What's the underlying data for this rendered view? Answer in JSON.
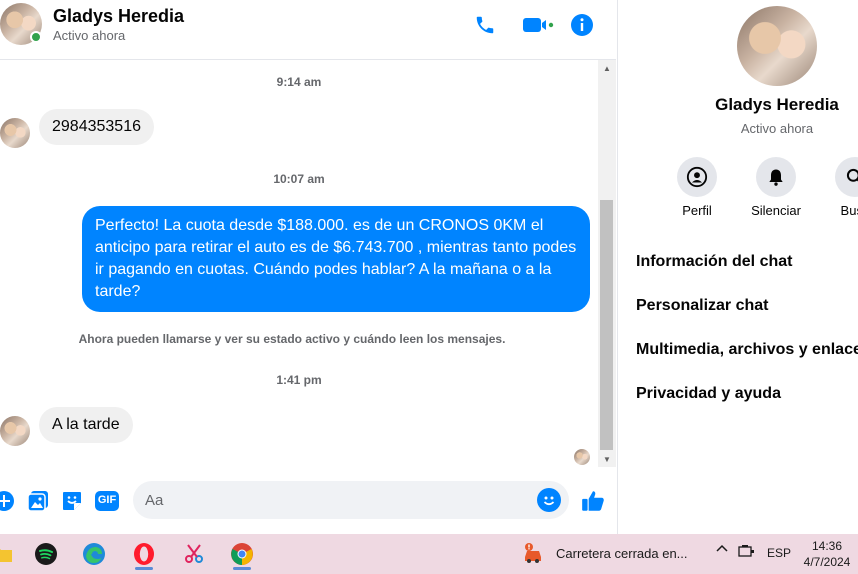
{
  "header": {
    "name": "Gladys Heredia",
    "status": "Activo ahora"
  },
  "chat": {
    "timestamps": [
      "9:14 am",
      "10:07 am",
      "1:41 pm"
    ],
    "messages": {
      "in1": "2984353516",
      "out1": "Perfecto! La cuota desde $188.000. es de un CRONOS 0KM el anticipo para retirar el auto es de $6.743.700 , mientras tanto podes ir pagando en cuotas. Cuándo podes hablar? A la mañana o a la tarde?",
      "in2": "A la tarde"
    },
    "notice": "Ahora pueden llamarse y ver su estado activo y cuándo leen los mensajes."
  },
  "composer": {
    "placeholder": "Aa",
    "gif_label": "GIF"
  },
  "side": {
    "name": "Gladys Heredia",
    "status": "Activo ahora",
    "actions": [
      {
        "label": "Perfil"
      },
      {
        "label": "Silenciar"
      },
      {
        "label": "Busc"
      }
    ],
    "menu": [
      "Información del chat",
      "Personalizar chat",
      "Multimedia, archivos y enlace",
      "Privacidad y ayuda"
    ]
  },
  "taskbar": {
    "weather": "Carretera cerrada en...",
    "lang": "ESP",
    "time": "14:36",
    "date": "4/7/2024"
  },
  "colors": {
    "accent": "#0084ff",
    "online": "#31a24c",
    "taskbar": "#efd9e2"
  }
}
